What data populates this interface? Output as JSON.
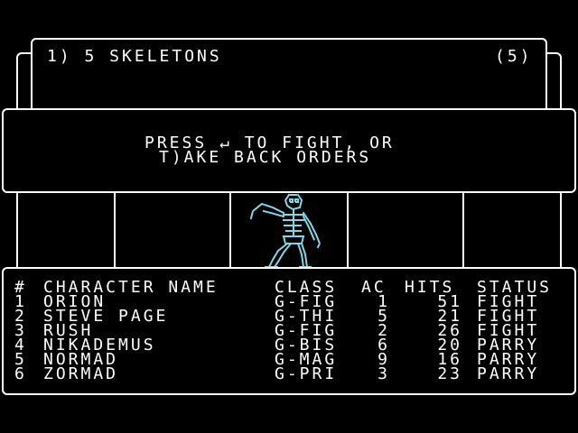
{
  "encounter": {
    "group_label": "1) 5 SKELETONS",
    "group_count": "(5)"
  },
  "prompt": {
    "line1_before": "PRESS",
    "enter_symbol": "↵",
    "line1_after": "TO FIGHT, OR",
    "line2": "T)AKE BACK ORDERS"
  },
  "party": {
    "headers": {
      "num": "#",
      "name": "CHARACTER NAME",
      "class": "CLASS",
      "ac": "AC",
      "hits": "HITS",
      "status": "STATUS"
    },
    "rows": [
      {
        "num": "1",
        "name": "ORION",
        "class": "G-FIG",
        "ac": "1",
        "hits": "51",
        "status": "FIGHT"
      },
      {
        "num": "2",
        "name": "STEVE PAGE",
        "class": "G-THI",
        "ac": "5",
        "hits": "21",
        "status": "FIGHT"
      },
      {
        "num": "3",
        "name": "RUSH",
        "class": "G-FIG",
        "ac": "2",
        "hits": "26",
        "status": "FIGHT"
      },
      {
        "num": "4",
        "name": "NIKADEMUS",
        "class": "G-BIS",
        "ac": "6",
        "hits": "20",
        "status": "PARRY"
      },
      {
        "num": "5",
        "name": "NORMAD",
        "class": "G-MAG",
        "ac": "9",
        "hits": "16",
        "status": "PARRY"
      },
      {
        "num": "6",
        "name": "ZORMAD",
        "class": "G-PRI",
        "ac": "3",
        "hits": "23",
        "status": "PARRY"
      }
    ]
  },
  "colors": {
    "monster": "#7fd8e8"
  },
  "icons": {
    "monster": "skeleton-sprite",
    "enter": "enter-key-icon"
  }
}
